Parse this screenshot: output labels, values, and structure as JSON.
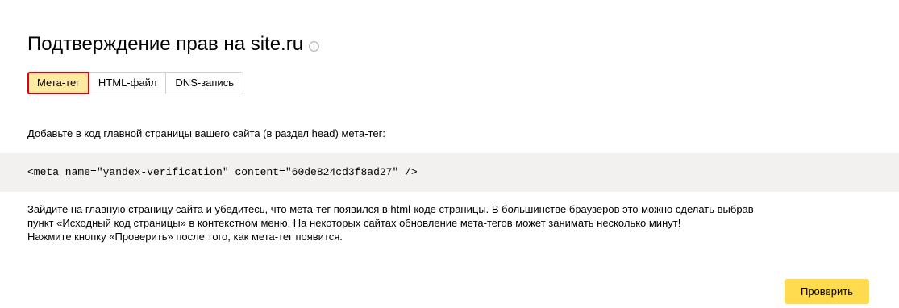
{
  "header": {
    "title": "Подтверждение прав на site.ru",
    "info_icon": "info-circle-icon"
  },
  "tabs": [
    {
      "label": "Мета-тег",
      "active": true
    },
    {
      "label": "HTML-файл",
      "active": false
    },
    {
      "label": "DNS-запись",
      "active": false
    }
  ],
  "content": {
    "instruction": "Добавьте в код главной страницы вашего сайта (в раздел head) мета-тег:",
    "code": "<meta name=\"yandex-verification\" content=\"60de824cd3f8ad27\" />",
    "description_lines": [
      "Зайдите на главную страницу сайта и убедитесь, что мета-тег появился в html-коде страницы. В большинстве браузеров это можно сделать выбрав",
      "пункт «Исходный код страницы» в контекстном меню. На некоторых сайтах обновление мета-тегов может занимать несколько минут!",
      "Нажмите кнопку «Проверить» после того, как мета-тег появится."
    ]
  },
  "actions": {
    "verify_label": "Проверить"
  },
  "colors": {
    "active_tab_bg": "#ffeba0",
    "active_tab_border": "#e0000f",
    "code_bg": "#f2f1f0",
    "button_bg": "#ffdb4d"
  }
}
